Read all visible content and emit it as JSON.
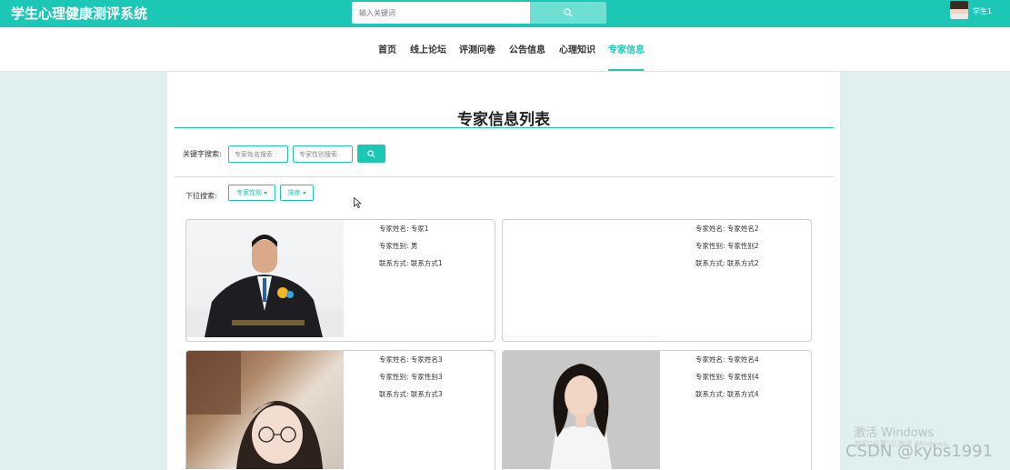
{
  "header": {
    "app_title": "学生心理健康测评系统",
    "search_placeholder": "输入关键词",
    "user_name": "学生1"
  },
  "nav": {
    "items": [
      {
        "label": "首页"
      },
      {
        "label": "线上论坛"
      },
      {
        "label": "评测问卷"
      },
      {
        "label": "公告信息"
      },
      {
        "label": "心理知识"
      },
      {
        "label": "专家信息",
        "active": true
      }
    ]
  },
  "main": {
    "title": "专家信息列表",
    "keyword_label": "关键字搜索:",
    "name_search_placeholder": "专家姓名搜索",
    "gender_search_placeholder": "专家性别搜索",
    "dropdown_label": "下拉搜索:",
    "gender_dropdown_label": "专家性别",
    "sort_dropdown_label": "排序"
  },
  "experts": [
    {
      "name_line": "专家姓名: 专家1",
      "gender_line": "专家性别: 男",
      "contact_line": "联系方式: 联系方式1",
      "photo": "man-in-suit-photo"
    },
    {
      "name_line": "专家姓名: 专家姓名2",
      "gender_line": "专家性别: 专家性别2",
      "contact_line": "联系方式: 联系方式2",
      "photo": "blank-photo"
    },
    {
      "name_line": "专家姓名: 专家姓名3",
      "gender_line": "专家性别: 专家性别3",
      "contact_line": "联系方式: 联系方式3",
      "photo": "girl-with-glasses-photo"
    },
    {
      "name_line": "专家姓名: 专家姓名4",
      "gender_line": "专家性别: 专家性别4",
      "contact_line": "联系方式: 联系方式4",
      "photo": "woman-portrait-photo"
    }
  ],
  "overlay": {
    "activate_windows_title": "激活 Windows",
    "activate_windows_subtitle": "转到\"设置\"以激活 Windows。",
    "csdn_watermark": "CSDN @kybs1991"
  },
  "colors": {
    "accent": "#1cc7b6",
    "page_background": "#dff0ef"
  }
}
